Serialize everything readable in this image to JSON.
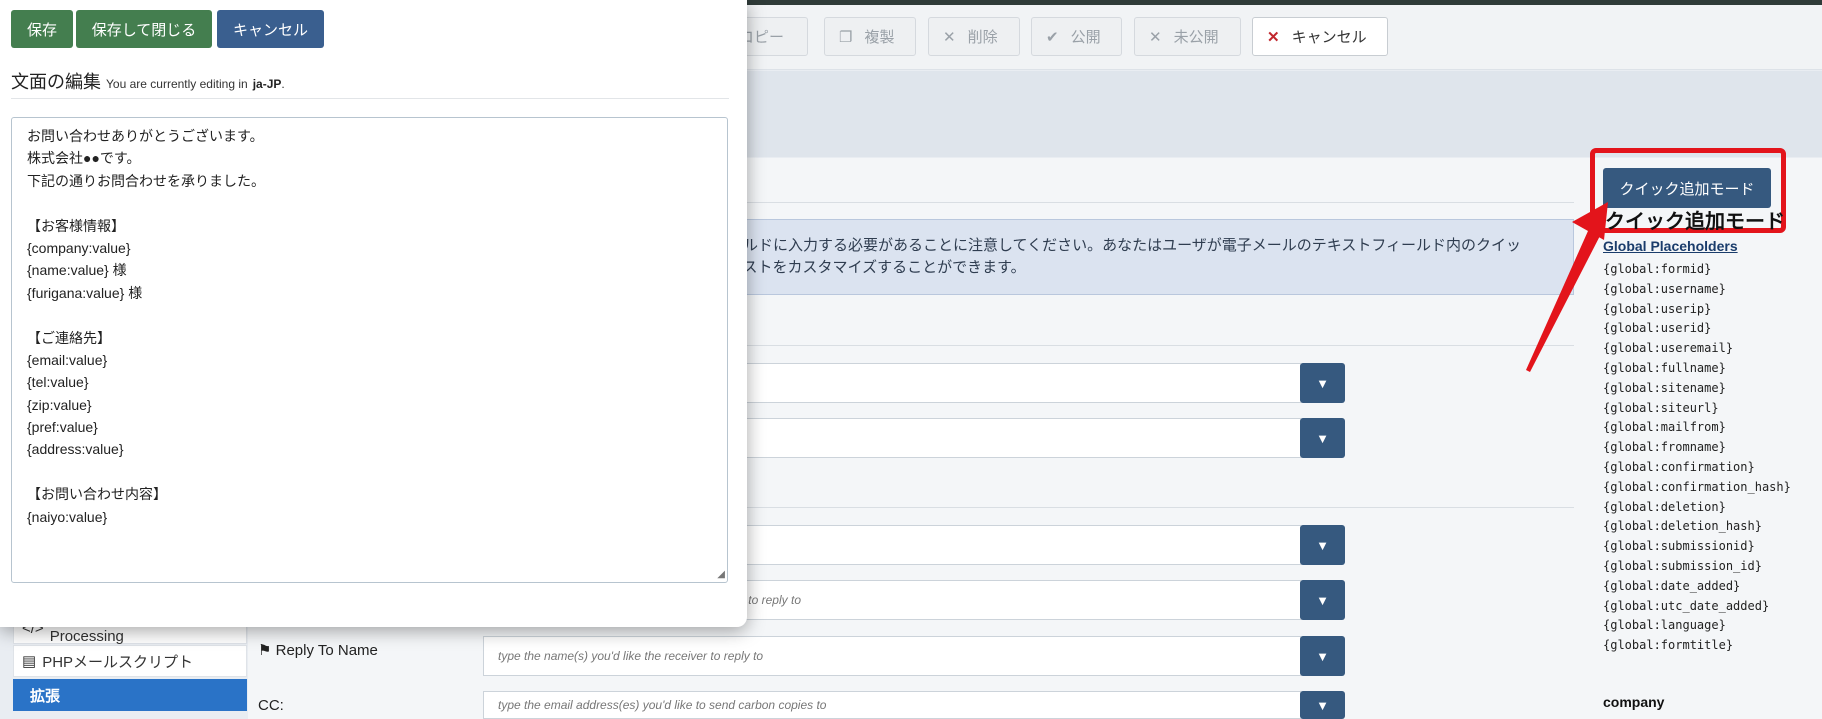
{
  "toolbar": {
    "buttons": [
      {
        "label": "コピー",
        "icon": "copy-icon"
      },
      {
        "label": "複製",
        "icon": "duplicate-icon"
      },
      {
        "label": "削除",
        "icon": "x-icon"
      },
      {
        "label": "公開",
        "icon": "check-icon"
      },
      {
        "label": "未公開",
        "icon": "x-icon"
      },
      {
        "label": "キャンセル",
        "icon": "x-icon"
      }
    ]
  },
  "alert": {
    "line1": "ィールドに入力する必要があることに注意してください。あなたはユーザが電子メールのテキストフィールド内のクイッ",
    "line2": "テキストをカスタマイズすることができます。"
  },
  "fields": {
    "reply_to_placeholder": "r to reply to",
    "reply_to_name_label": "Reply To Name",
    "reply_to_name_placeholder": "type the name(s) you'd like the receiver to reply to",
    "cc_label": "CC:",
    "cc_placeholder": "type the email address(es) you'd like to send carbon copies to"
  },
  "left_nav": {
    "php_pre": "PHP Scripts - Pre-Processing",
    "php_mail": "PHPメールスクリプト",
    "extend": "拡張"
  },
  "right_panel": {
    "quick_button": "クイック追加モード",
    "quick_title": "クイック追加モード",
    "global_title": "Global Placeholders",
    "placeholders": [
      "{global:formid}",
      "{global:username}",
      "{global:userip}",
      "{global:userid}",
      "{global:useremail}",
      "{global:fullname}",
      "{global:sitename}",
      "{global:siteurl}",
      "{global:mailfrom}",
      "{global:fromname}",
      "{global:confirmation}",
      "{global:confirmation_hash}",
      "{global:deletion}",
      "{global:deletion_hash}",
      "{global:submissionid}",
      "{global:submission_id}",
      "{global:date_added}",
      "{global:utc_date_added}",
      "{global:language}",
      "{global:formtitle}"
    ],
    "field_heading": "company"
  },
  "modal": {
    "save": "保存",
    "save_close": "保存して閉じる",
    "cancel": "キャンセル",
    "title": "文面の編集",
    "editing_prefix": "You are currently editing in",
    "editing_lang": "ja-JP",
    "lines": [
      "お問い合わせありがとうございます。",
      "株式会社●●です。",
      "下記の通りお問合わせを承りました。",
      "",
      "【お客様情報】",
      "{company:value}",
      "{name:value} 様",
      "{furigana:value} 様",
      "",
      "【ご連絡先】",
      "{email:value}",
      "{tel:value}",
      "{zip:value}",
      "{pref:value}",
      "{address:value}",
      "",
      "【お問い合わせ内容】",
      "{naiyo:value}"
    ]
  },
  "colors": {
    "primary": "#36597f",
    "success": "#447e4f",
    "danger": "#e3141b",
    "active_nav": "#2a73c7"
  }
}
